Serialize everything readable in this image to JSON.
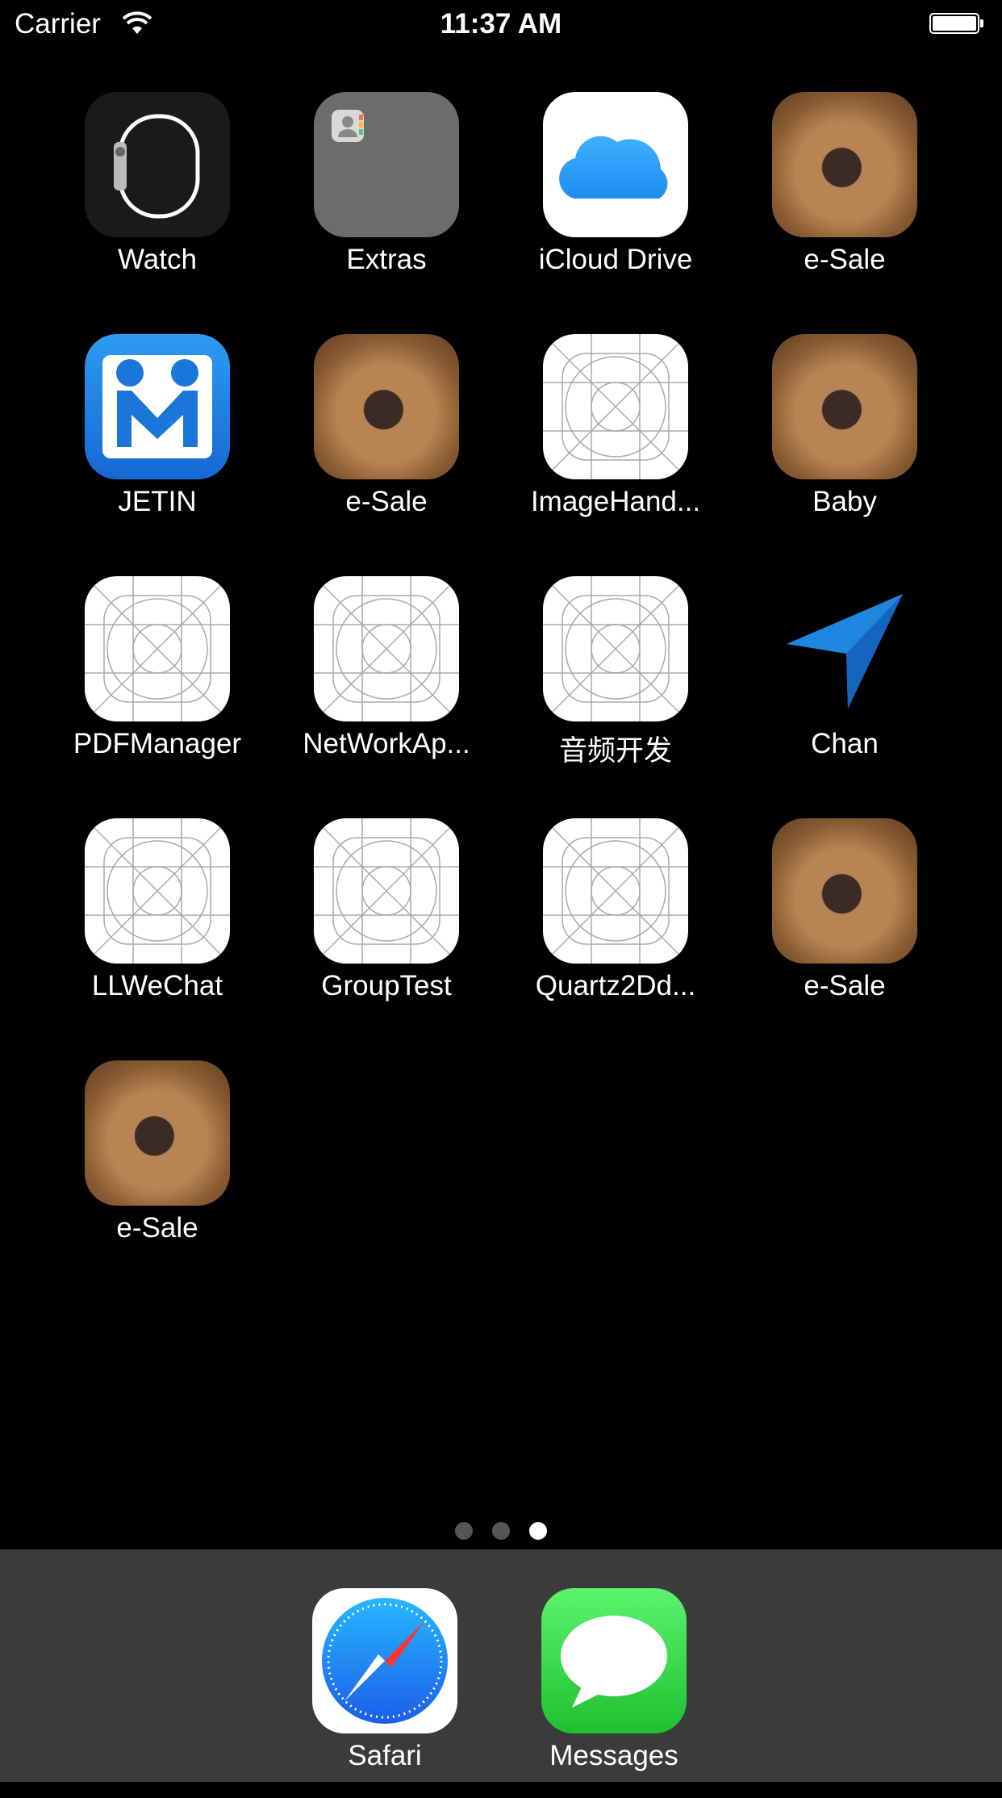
{
  "status_bar": {
    "carrier": "Carrier",
    "time": "11:37 AM"
  },
  "apps": [
    {
      "label": "Watch",
      "icon": "watch-icon"
    },
    {
      "label": "Extras",
      "icon": "folder-icon"
    },
    {
      "label": "iCloud Drive",
      "icon": "icloud-icon"
    },
    {
      "label": "e-Sale",
      "icon": "dog-photo-icon"
    },
    {
      "label": "JETIN",
      "icon": "jetin-icon"
    },
    {
      "label": "e-Sale",
      "icon": "dog-photo-icon"
    },
    {
      "label": "ImageHand...",
      "icon": "placeholder-grid-icon"
    },
    {
      "label": "Baby",
      "icon": "dog-photo-icon"
    },
    {
      "label": "PDFManager",
      "icon": "placeholder-grid-icon"
    },
    {
      "label": "NetWorkAp...",
      "icon": "placeholder-grid-icon"
    },
    {
      "label": "音频开发",
      "icon": "placeholder-grid-icon"
    },
    {
      "label": "Chan",
      "icon": "location-arrow-icon"
    },
    {
      "label": "LLWeChat",
      "icon": "placeholder-grid-icon"
    },
    {
      "label": "GroupTest",
      "icon": "placeholder-grid-icon"
    },
    {
      "label": "Quartz2Dd...",
      "icon": "placeholder-grid-icon"
    },
    {
      "label": "e-Sale",
      "icon": "dog-photo-icon"
    },
    {
      "label": "e-Sale",
      "icon": "dog-photo-icon"
    }
  ],
  "page_indicator": {
    "pages": 3,
    "current": 3
  },
  "dock": [
    {
      "label": "Safari",
      "icon": "safari-compass-icon"
    },
    {
      "label": "Messages",
      "icon": "messages-bubble-icon"
    }
  ]
}
